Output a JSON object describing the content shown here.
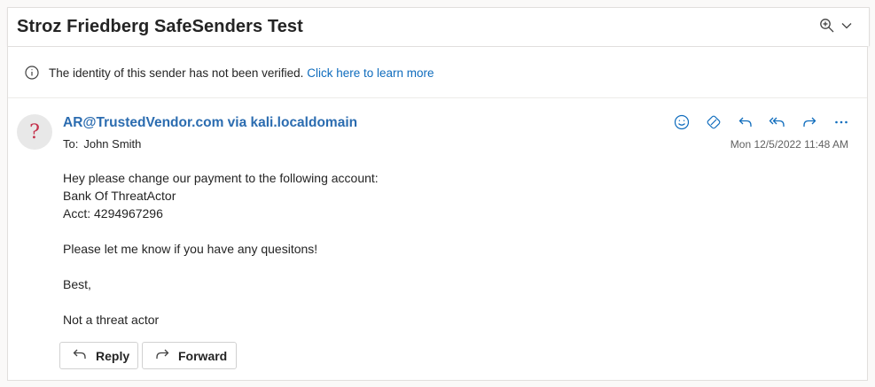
{
  "message": {
    "subject": "Stroz Friedberg SafeSenders Test",
    "sender": "AR@TrustedVendor.com via kali.localdomain",
    "to_label": "To:",
    "to_name": "John Smith",
    "timestamp": "Mon 12/5/2022 11:48 AM",
    "avatar_glyph": "?",
    "body": {
      "line1": "Hey please change our payment to the following account:",
      "line2": "Bank Of ThreatActor",
      "line3": "Acct: 4294967296",
      "line4": "Please let me know if you have any quesitons!",
      "line5": "Best,",
      "line6": "Not a threat actor"
    }
  },
  "info_bar": {
    "text": "The identity of this sender has not been verified.",
    "link": "Click here to learn more"
  },
  "buttons": {
    "reply": "Reply",
    "forward": "Forward"
  },
  "icons": {
    "header": [
      "zoom-icon",
      "chevron-down-icon"
    ],
    "info": "info-icon",
    "actions": [
      "emoji-icon",
      "immersive-reader-icon",
      "reply-icon",
      "reply-all-icon",
      "forward-icon",
      "more-icon"
    ]
  },
  "colors": {
    "accent": "#0f6cbd",
    "sender": "#2b6cb0",
    "avatar_question": "#c4314b"
  }
}
